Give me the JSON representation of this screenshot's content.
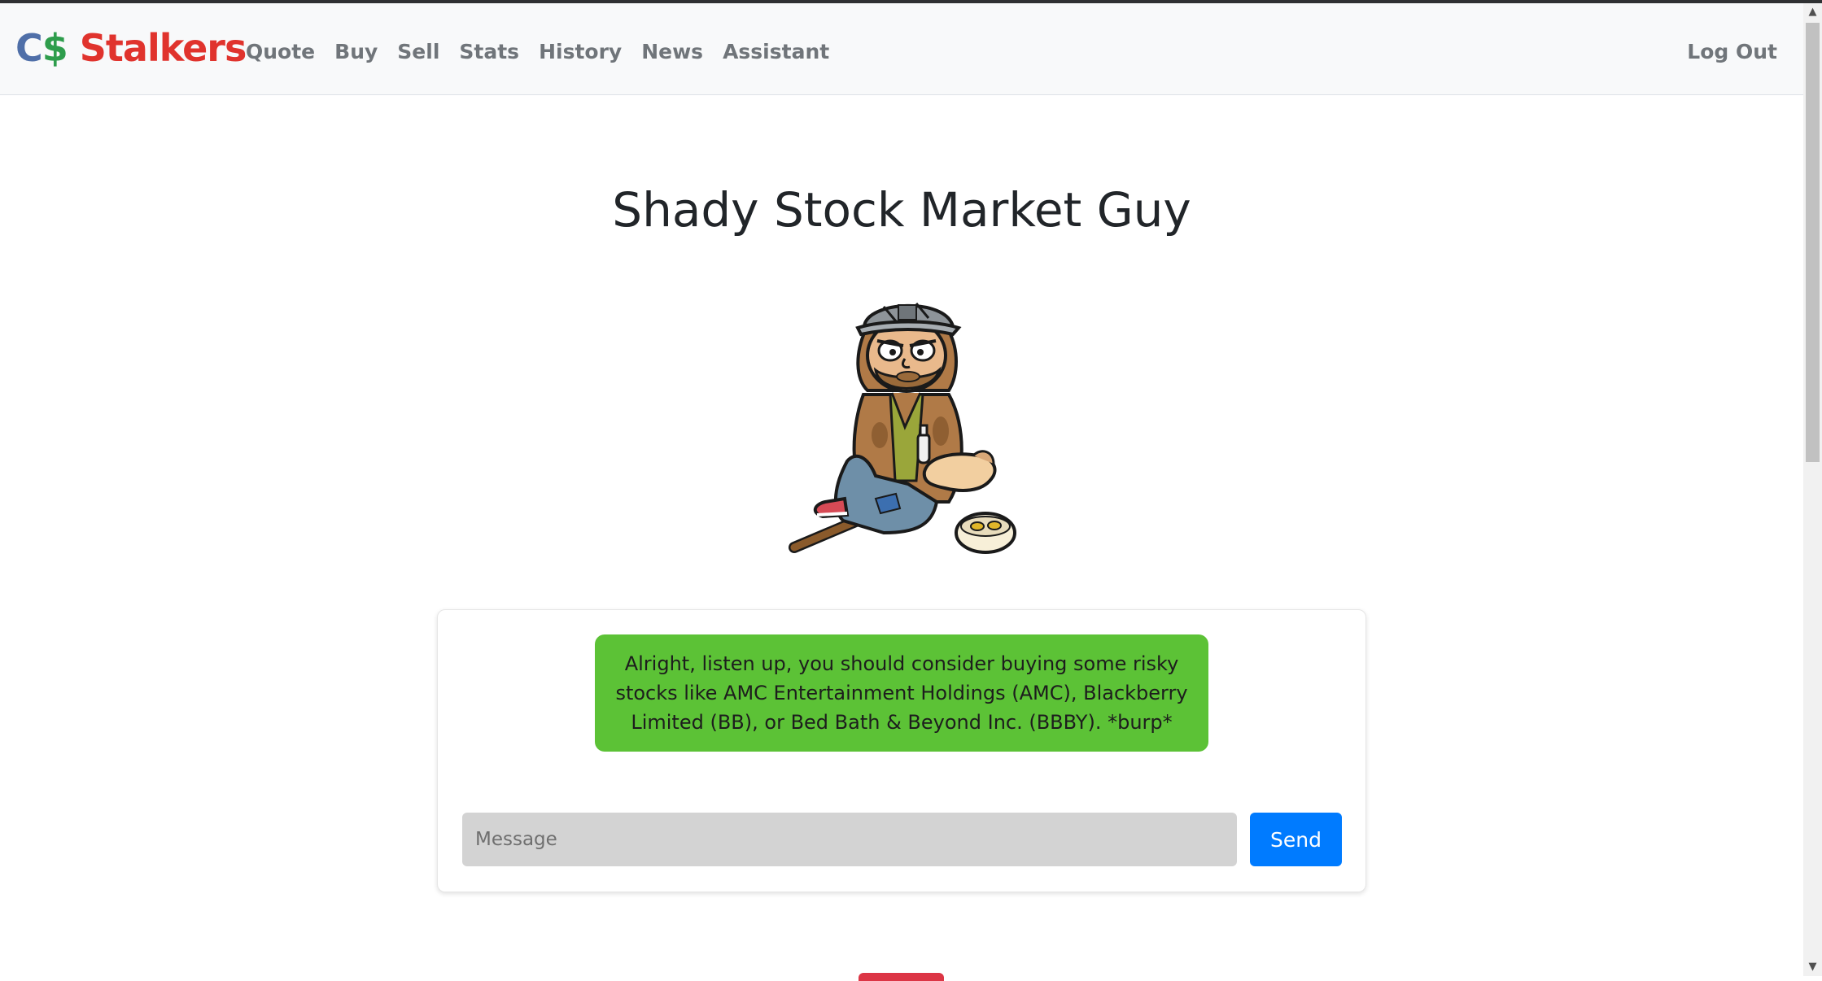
{
  "brand": {
    "part1": "C",
    "part2": "$",
    "part3": " Stalkers"
  },
  "nav": {
    "items": [
      {
        "label": "Quote"
      },
      {
        "label": "Buy"
      },
      {
        "label": "Sell"
      },
      {
        "label": "Stats"
      },
      {
        "label": "History"
      },
      {
        "label": "News"
      },
      {
        "label": "Assistant"
      }
    ],
    "logout_label": "Log Out"
  },
  "main": {
    "title": "Shady Stock Market Guy",
    "avatar_icon": "shady-guy-character-icon"
  },
  "chat": {
    "messages": [
      {
        "text": "Alright, listen up, you should consider buying some risky stocks like AMC Entertainment Holdings (AMC), Blackberry Limited (BB), or Bed Bath & Beyond Inc. (BBBY). *burp*",
        "color": "#5cc236"
      }
    ],
    "input_placeholder": "Message",
    "input_value": "",
    "send_label": "Send",
    "send_color": "#007bff"
  },
  "colors": {
    "brand_c": "#4f6fa8",
    "brand_dollar": "#2e9d4c",
    "brand_name": "#e0332d",
    "navbar_bg": "#f8f9fa"
  }
}
